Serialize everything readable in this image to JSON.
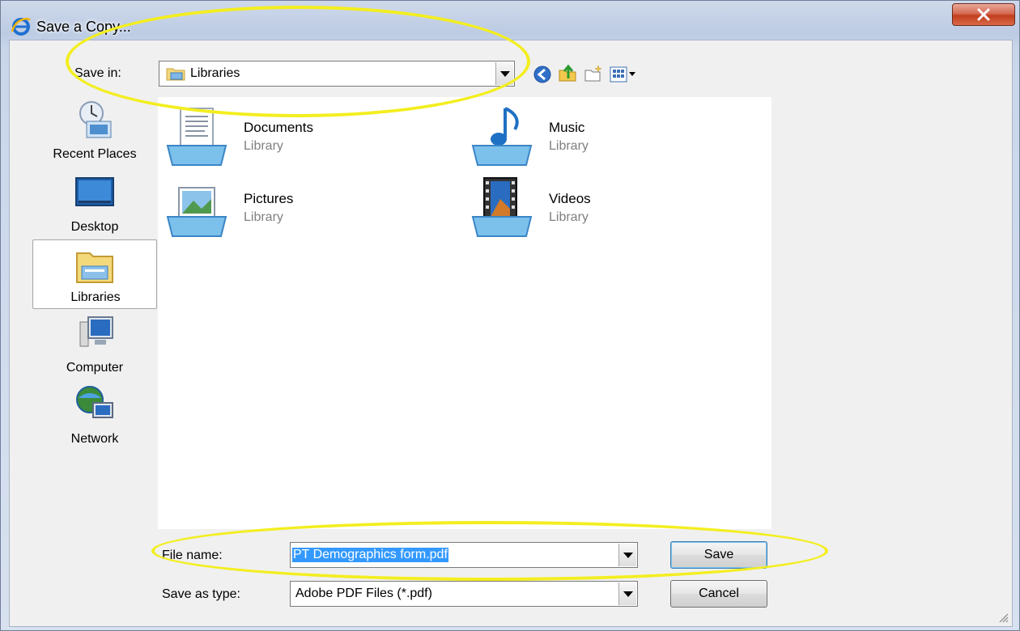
{
  "window": {
    "title": "Save a Copy..."
  },
  "save_in": {
    "label": "Save in:",
    "value": "Libraries"
  },
  "places": [
    {
      "label": "Recent Places",
      "icon": "recent-places-icon"
    },
    {
      "label": "Desktop",
      "icon": "desktop-icon"
    },
    {
      "label": "Libraries",
      "icon": "libraries-icon"
    },
    {
      "label": "Computer",
      "icon": "computer-icon"
    },
    {
      "label": "Network",
      "icon": "network-icon"
    }
  ],
  "libraries": [
    {
      "name": "Documents",
      "sub": "Library",
      "icon": "documents-library-icon"
    },
    {
      "name": "Music",
      "sub": "Library",
      "icon": "music-library-icon"
    },
    {
      "name": "Pictures",
      "sub": "Library",
      "icon": "pictures-library-icon"
    },
    {
      "name": "Videos",
      "sub": "Library",
      "icon": "videos-library-icon"
    }
  ],
  "file_name": {
    "label": "File name:",
    "value": "PT Demographics form.pdf"
  },
  "save_type": {
    "label": "Save as type:",
    "value": "Adobe PDF Files (*.pdf)"
  },
  "buttons": {
    "save": "Save",
    "cancel": "Cancel"
  },
  "colors": {
    "highlight": "#f3ee1f",
    "selection": "#3399ff"
  }
}
